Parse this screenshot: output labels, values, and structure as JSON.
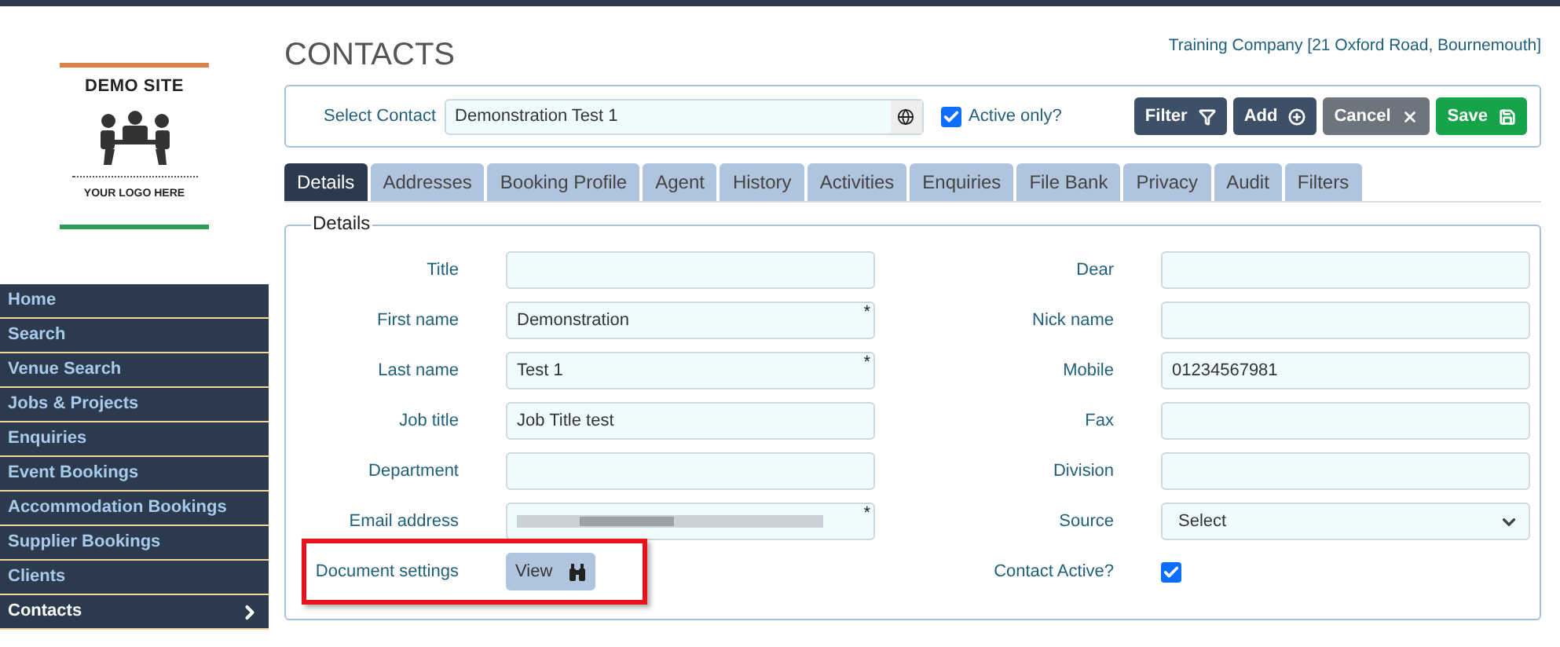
{
  "logo": {
    "title": "DEMO SITE",
    "tagline": "YOUR LOGO HERE"
  },
  "nav": [
    {
      "label": "Home",
      "selected": false
    },
    {
      "label": "Search",
      "selected": false
    },
    {
      "label": "Venue Search",
      "selected": false
    },
    {
      "label": "Jobs & Projects",
      "selected": false
    },
    {
      "label": "Enquiries",
      "selected": false
    },
    {
      "label": "Event Bookings",
      "selected": false
    },
    {
      "label": "Accommodation Bookings",
      "selected": false
    },
    {
      "label": "Supplier Bookings",
      "selected": false
    },
    {
      "label": "Clients",
      "selected": false
    },
    {
      "label": "Contacts",
      "selected": true
    }
  ],
  "page_title": "CONTACTS",
  "company": "Training Company [21 Oxford Road, Bournemouth]",
  "select_contact": {
    "label": "Select Contact",
    "value": "Demonstration Test 1",
    "active_only_label": "Active only?",
    "active_only": true
  },
  "actions": [
    {
      "label": "Filter",
      "kind": "filter"
    },
    {
      "label": "Add",
      "kind": "add"
    },
    {
      "label": "Cancel",
      "kind": "cancel"
    },
    {
      "label": "Save",
      "kind": "save"
    }
  ],
  "tabs": [
    {
      "label": "Details",
      "selected": true
    },
    {
      "label": "Addresses",
      "selected": false
    },
    {
      "label": "Booking Profile",
      "selected": false
    },
    {
      "label": "Agent",
      "selected": false
    },
    {
      "label": "History",
      "selected": false
    },
    {
      "label": "Activities",
      "selected": false
    },
    {
      "label": "Enquiries",
      "selected": false
    },
    {
      "label": "File Bank",
      "selected": false
    },
    {
      "label": "Privacy",
      "selected": false
    },
    {
      "label": "Audit",
      "selected": false
    },
    {
      "label": "Filters",
      "selected": false
    }
  ],
  "details": {
    "legend": "Details",
    "left": [
      {
        "label": "Title",
        "kind": "input"
      },
      {
        "label": "First name",
        "kind": "input",
        "value": "Demonstration",
        "required_mark": "*"
      },
      {
        "label": "Last name",
        "kind": "input",
        "value": "Test 1",
        "required_mark": "*"
      },
      {
        "label": "Job title",
        "kind": "input",
        "value": "Job Title test"
      },
      {
        "label": "Department",
        "kind": "input"
      },
      {
        "label": "Email address",
        "kind": "redacted",
        "required_mark": "*"
      },
      {
        "label": "Document settings",
        "kind": "button",
        "button": "View",
        "highlighted": true
      }
    ],
    "right": [
      {
        "label": "Dear",
        "kind": "input"
      },
      {
        "label": "Nick name",
        "kind": "input"
      },
      {
        "label": "Mobile",
        "kind": "input",
        "value": "01234567981"
      },
      {
        "label": "Fax",
        "kind": "input"
      },
      {
        "label": "Division",
        "kind": "input"
      },
      {
        "label": "Source",
        "kind": "select",
        "value": "Select"
      },
      {
        "label": "Contact Active?",
        "kind": "checkbox",
        "checked": true
      }
    ]
  }
}
